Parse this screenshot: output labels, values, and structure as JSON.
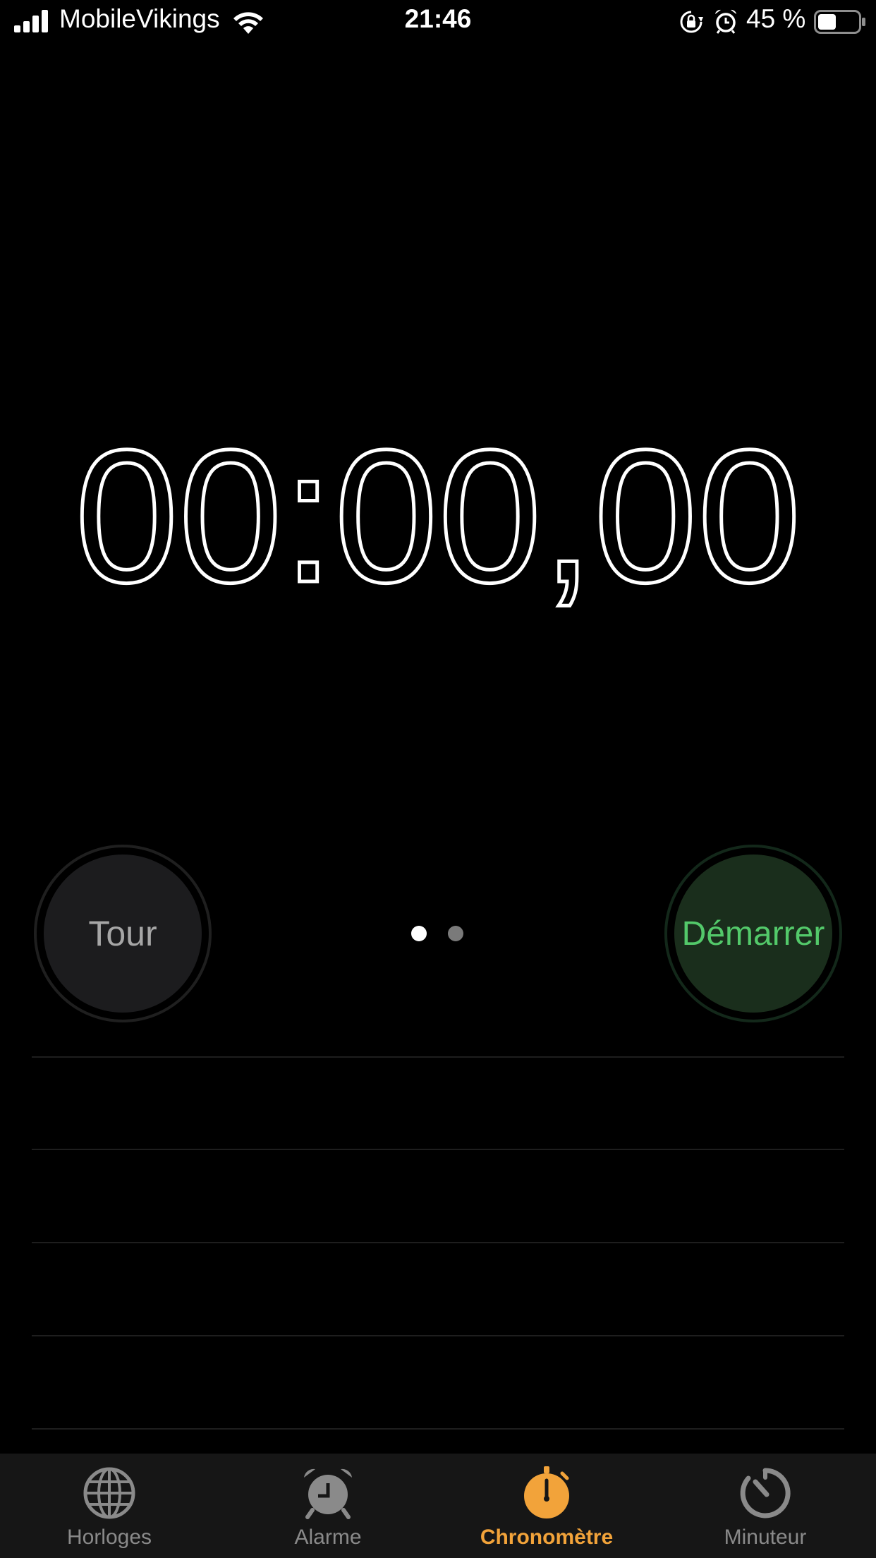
{
  "status_bar": {
    "carrier": "MobileVikings",
    "time": "21:46",
    "battery_percent": "45 %",
    "battery_level": 0.45
  },
  "stopwatch": {
    "time_display": "00:00,00"
  },
  "controls": {
    "lap_label": "Tour",
    "start_label": "Démarrer",
    "page_indicator": {
      "count": 2,
      "active_index": 0
    }
  },
  "tab_bar": {
    "tabs": [
      {
        "label": "Horloges",
        "icon": "globe-icon",
        "active": false
      },
      {
        "label": "Alarme",
        "icon": "alarm-clock-icon",
        "active": false
      },
      {
        "label": "Chronomètre",
        "icon": "stopwatch-icon",
        "active": true
      },
      {
        "label": "Minuteur",
        "icon": "timer-icon",
        "active": false
      }
    ]
  },
  "colors": {
    "accent": "#f2a33a",
    "start_green": "#53c96a",
    "start_bg": "#1a2e1c",
    "lap_bg": "#1c1c1e",
    "inactive_tab": "#8a8a8a"
  }
}
